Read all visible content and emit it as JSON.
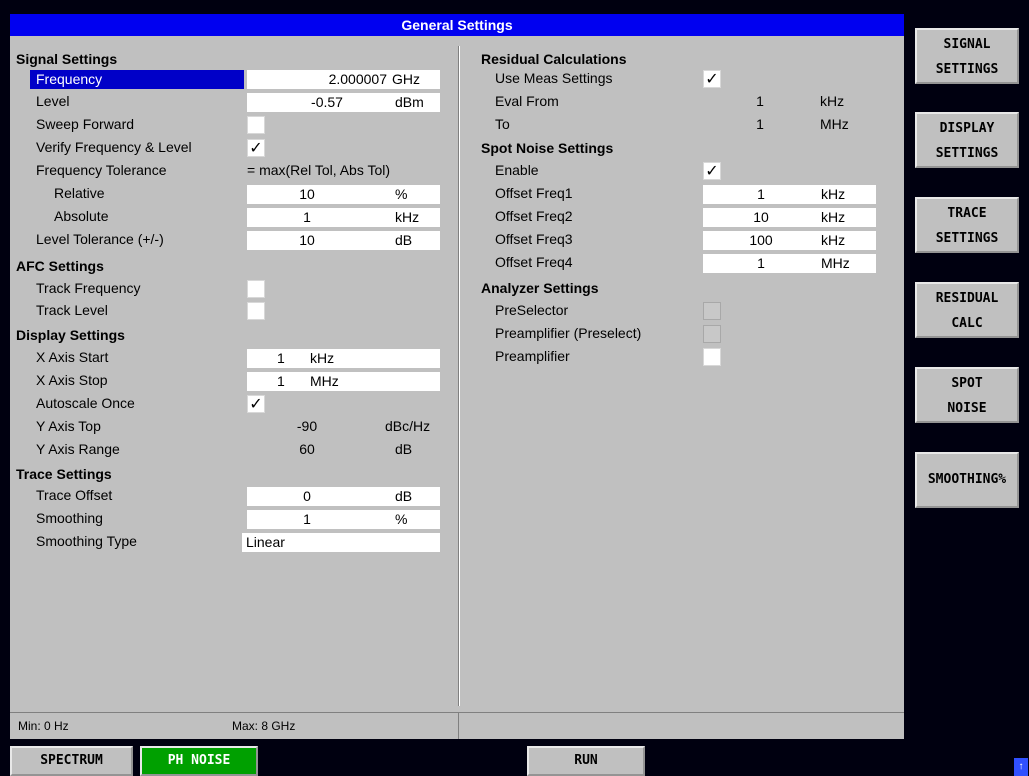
{
  "title": "General Settings",
  "signal": {
    "header": "Signal Settings",
    "frequency": {
      "label": "Frequency",
      "value": "2.000007",
      "unit": "GHz"
    },
    "level": {
      "label": "Level",
      "value": "-0.57",
      "unit": "dBm"
    },
    "sweep_forward": {
      "label": "Sweep Forward"
    },
    "verify": {
      "label": "Verify Frequency & Level",
      "mark": "✓"
    },
    "freq_tol": {
      "label": "Frequency Tolerance",
      "value": "= max(Rel Tol, Abs Tol)"
    },
    "relative": {
      "label": "Relative",
      "value": "10",
      "unit": "%"
    },
    "absolute": {
      "label": "Absolute",
      "value": "1",
      "unit": "kHz"
    },
    "level_tol": {
      "label": "Level Tolerance (+/-)",
      "value": "10",
      "unit": "dB"
    }
  },
  "afc": {
    "header": "AFC Settings",
    "track_freq": {
      "label": "Track Frequency"
    },
    "track_level": {
      "label": "Track Level"
    }
  },
  "display": {
    "header": "Display Settings",
    "x_start": {
      "label": "X Axis Start",
      "value": "1",
      "unit": "kHz"
    },
    "x_stop": {
      "label": "X Axis Stop",
      "value": "1",
      "unit": "MHz"
    },
    "autoscale": {
      "label": "Autoscale Once",
      "mark": "✓"
    },
    "y_top": {
      "label": "Y Axis Top",
      "value": "-90",
      "unit": "dBc/Hz"
    },
    "y_range": {
      "label": "Y Axis Range",
      "value": "60",
      "unit": "dB"
    }
  },
  "trace": {
    "header": "Trace Settings",
    "offset": {
      "label": "Trace Offset",
      "value": "0",
      "unit": "dB"
    },
    "smoothing": {
      "label": "Smoothing",
      "value": "1",
      "unit": "%"
    },
    "smoothing_type": {
      "label": "Smoothing Type",
      "value": "Linear"
    }
  },
  "residual": {
    "header": "Residual Calculations",
    "use_meas": {
      "label": "Use Meas Settings",
      "mark": "✓"
    },
    "eval_from": {
      "label": "Eval From",
      "value": "1",
      "unit": "kHz"
    },
    "to": {
      "label": "To",
      "value": "1",
      "unit": "MHz"
    }
  },
  "spot": {
    "header": "Spot Noise Settings",
    "enable": {
      "label": "Enable",
      "mark": "✓"
    },
    "f1": {
      "label": "Offset Freq1",
      "value": "1",
      "unit": "kHz"
    },
    "f2": {
      "label": "Offset Freq2",
      "value": "10",
      "unit": "kHz"
    },
    "f3": {
      "label": "Offset Freq3",
      "value": "100",
      "unit": "kHz"
    },
    "f4": {
      "label": "Offset Freq4",
      "value": "1",
      "unit": "MHz"
    }
  },
  "analyzer": {
    "header": "Analyzer Settings",
    "preselector": {
      "label": "PreSelector"
    },
    "preamp_presel": {
      "label": "Preamplifier (Preselect)"
    },
    "preamp": {
      "label": "Preamplifier"
    }
  },
  "status": {
    "min": "Min: 0 Hz",
    "max": "Max: 8 GHz"
  },
  "softkeys": [
    {
      "line1": "SIGNAL",
      "line2": "SETTINGS"
    },
    {
      "line1": "DISPLAY",
      "line2": "SETTINGS"
    },
    {
      "line1": "TRACE",
      "line2": "SETTINGS"
    },
    {
      "line1": "RESIDUAL",
      "line2": "CALC"
    },
    {
      "line1": "SPOT",
      "line2": "NOISE"
    },
    {
      "line1": "SMOOTHING%",
      "line2": ""
    }
  ],
  "tabs": {
    "spectrum": "SPECTRUM",
    "ph_noise": "PH NOISE",
    "run": "RUN"
  },
  "corner_icon": "up-arrow-icon",
  "colors": {
    "title_bar": "#0000f0",
    "panel": "#c0c0c0",
    "selected": "#0000c8",
    "active_tab": "#00a000"
  }
}
